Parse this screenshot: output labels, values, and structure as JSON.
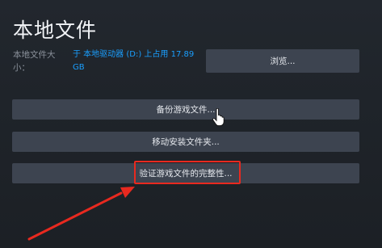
{
  "dialog": {
    "title": "本地文件",
    "size_label": "本地文件大小：",
    "size_value": "于 本地驱动器 (D:) 上占用 17.89 GB",
    "browse_label": "浏览...",
    "backup_label": "备份游戏文件...",
    "move_label": "移动安装文件夹...",
    "verify_label": "验证游戏文件的完整性..."
  },
  "annotation": {
    "highlight_color": "#e8291f",
    "arrow_color": "#e8291f",
    "cursor_icon": "hand-pointer-icon"
  },
  "colors": {
    "background": "#1c2025",
    "button": "#3d4450",
    "accent_link": "#1a9fff"
  }
}
